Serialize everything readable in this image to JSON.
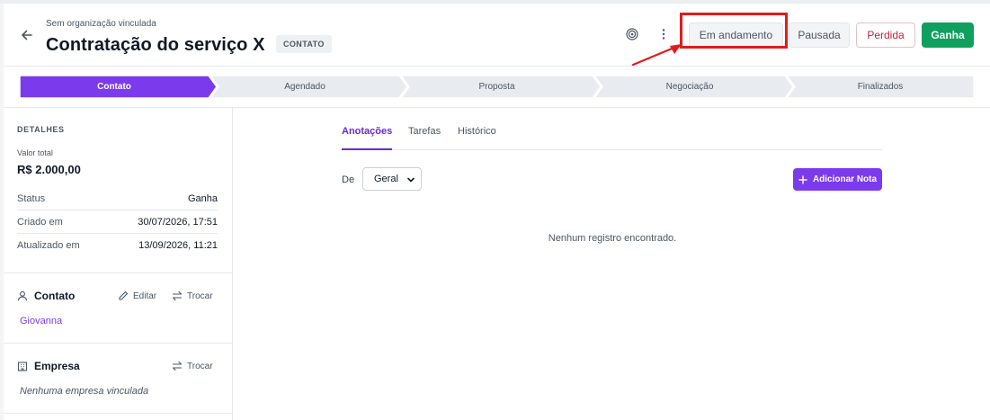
{
  "header": {
    "organization": "Sem organização vinculada",
    "title": "Contratação do serviço X",
    "tag": "CONTATO",
    "status_buttons": {
      "em_andamento": "Em andamento",
      "pausada": "Pausada",
      "perdida": "Perdida",
      "ganha": "Ganha"
    }
  },
  "pipeline": {
    "stages": [
      "Contato",
      "Agendado",
      "Proposta",
      "Negociação",
      "Finalizados"
    ],
    "active_index": 0,
    "colors": {
      "active": "#7c3aed",
      "inactive": "#e8ebef"
    }
  },
  "details": {
    "heading": "DETALHES",
    "valor_label": "Valor total",
    "valor": "R$ 2.000,00",
    "rows": [
      {
        "label": "Status",
        "value": "Ganha"
      },
      {
        "label": "Criado em",
        "value": "30/07/2026, 17:51"
      },
      {
        "label": "Atualizado em",
        "value": "13/09/2026, 11:21"
      }
    ]
  },
  "contact": {
    "heading": "Contato",
    "edit_label": "Editar",
    "swap_label": "Trocar",
    "name": "Giovanna"
  },
  "company": {
    "heading": "Empresa",
    "swap_label": "Trocar",
    "empty": "Nenhuma empresa vinculada"
  },
  "main": {
    "tabs": [
      "Anotações",
      "Tarefas",
      "Histórico"
    ],
    "filter_label": "De",
    "filter_value": "Geral",
    "add_note": "Adicionar Nota",
    "empty_message": "Nenhum registro encontrado."
  }
}
